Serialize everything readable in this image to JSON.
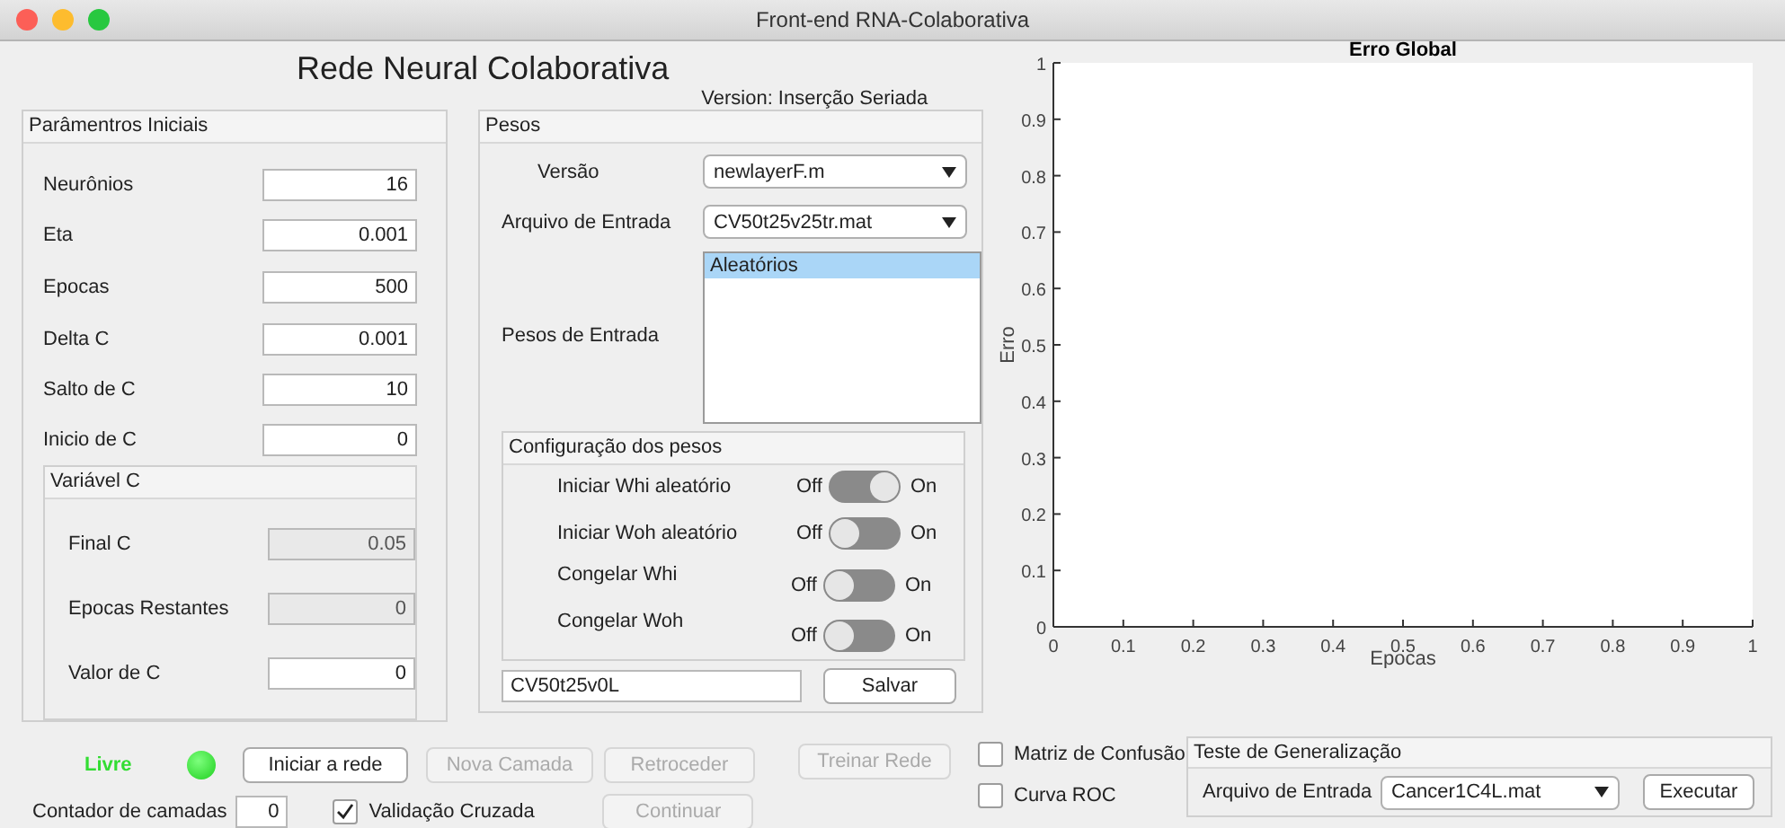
{
  "window": {
    "title": "Front-end RNA-Colaborativa"
  },
  "heading": "Rede Neural Colaborativa",
  "version": "Version: Inserção Seriada",
  "initial_params": {
    "title": "Parâmentros Iniciais",
    "fields": [
      {
        "label": "Neurônios",
        "value": "16"
      },
      {
        "label": "Eta",
        "value": "0.001"
      },
      {
        "label": "Epocas",
        "value": "500"
      },
      {
        "label": "Delta C",
        "value": "0.001"
      },
      {
        "label": "Salto de C",
        "value": "10"
      },
      {
        "label": "Inicio de C",
        "value": "0"
      }
    ],
    "variable_c": {
      "title": "Variável C",
      "fields": [
        {
          "label": "Final C",
          "value": "0.05",
          "disabled": true
        },
        {
          "label": "Epocas Restantes",
          "value": "0",
          "disabled": true
        },
        {
          "label": "Valor de C",
          "value": "0",
          "disabled": false
        }
      ]
    }
  },
  "weights": {
    "title": "Pesos",
    "selects": [
      {
        "label": "Versão",
        "value": "newlayerF.m"
      },
      {
        "label": "Arquivo de Entrada",
        "value": "CV50t25v25tr.mat"
      }
    ],
    "input_weights": {
      "label": "Pesos de Entrada",
      "items": [
        {
          "label": "Aleatórios",
          "selected": true
        }
      ]
    },
    "config": {
      "title": "Configuração dos pesos",
      "toggles": [
        {
          "label": "Iniciar Whi aleatório",
          "off_label": "Off",
          "on_label": "On",
          "on": true
        },
        {
          "label": "Iniciar Woh aleatório",
          "off_label": "Off",
          "on_label": "On",
          "on": false
        },
        {
          "label": "Congelar Whi",
          "off_label": "Off",
          "on_label": "On",
          "on": false
        },
        {
          "label": "Congelar Woh",
          "off_label": "Off",
          "on_label": "On",
          "on": false
        }
      ]
    },
    "save_name": "CV50t25v0L",
    "save_button": "Salvar"
  },
  "chart": {
    "chart_data": {
      "type": "line",
      "title": "Erro Global",
      "xlabel": "Epocas",
      "ylabel": "Erro",
      "xlim": [
        0,
        1
      ],
      "ylim": [
        0,
        1
      ],
      "xticks": [
        0,
        0.1,
        0.2,
        0.3,
        0.4,
        0.5,
        0.6,
        0.7,
        0.8,
        0.9,
        1
      ],
      "yticks": [
        0,
        0.1,
        0.2,
        0.3,
        0.4,
        0.5,
        0.6,
        0.7,
        0.8,
        0.9,
        1
      ]
    }
  },
  "controls": {
    "status": "Livre",
    "buttons": [
      {
        "label": "Iniciar a rede",
        "disabled": false
      },
      {
        "label": "Nova Camada",
        "disabled": true
      },
      {
        "label": "Retroceder",
        "disabled": true
      },
      {
        "label": "Treinar Rede",
        "disabled": true
      }
    ],
    "layer_counter": {
      "label": "Contador de camadas",
      "value": "0"
    },
    "cross_validation": {
      "label": "Validação Cruzada",
      "checked": true
    },
    "continue_button": {
      "label": "Continuar",
      "disabled": true
    }
  },
  "outputs": [
    {
      "label": "Matriz de Confusão",
      "checked": false
    },
    {
      "label": "Curva ROC",
      "checked": false
    }
  ],
  "generalization_test": {
    "title": "Teste de Generalização",
    "file_label": "Arquivo de Entrada",
    "file_value": "Cancer1C4L.mat",
    "button": "Executar"
  }
}
